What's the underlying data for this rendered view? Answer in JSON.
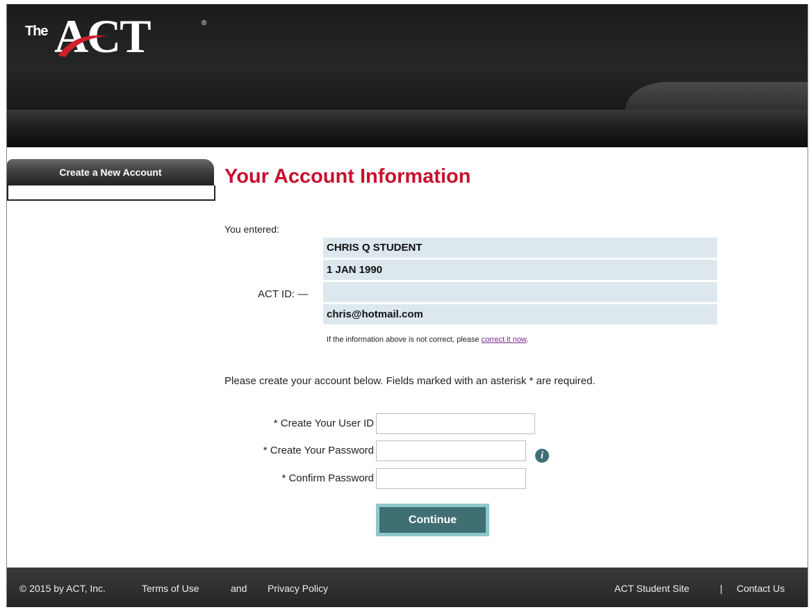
{
  "header": {
    "logo_the": "The",
    "logo_act": "ACT",
    "logo_reg": "®"
  },
  "sidebar": {
    "tab_label": "Create a New Account"
  },
  "main": {
    "title": "Your Account Information",
    "you_entered_label": "You entered:",
    "act_id_label": "ACT ID: —",
    "entered": {
      "name": "CHRIS Q STUDENT",
      "dob": "1 JAN 1990",
      "act_id": "",
      "email": "chris@hotmail.com"
    },
    "correct_note_prefix": "If the information above is not correct, please ",
    "correct_link": "correct it now",
    "correct_note_suffix": ".",
    "instructions": "Please create your account below. Fields marked with an asterisk * are required."
  },
  "form": {
    "user_id_label": "* Create Your User ID",
    "user_id_value": "",
    "password_label": "* Create Your Password",
    "password_value": "",
    "confirm_label": "* Confirm Password",
    "confirm_value": "",
    "info_icon": "info-icon",
    "continue_label": "Continue"
  },
  "footer": {
    "copyright": "© 2015 by ACT, Inc.",
    "terms": "Terms of Use",
    "and": "and",
    "privacy": "Privacy Policy",
    "student_site": "ACT Student Site",
    "separator": "|",
    "contact": "Contact Us"
  },
  "colors": {
    "title_red": "#c8102e",
    "button_teal": "#3f6f72",
    "button_border": "#8ec8cc",
    "info_row_bg": "#dce8ee",
    "link_purple": "#7a2a8a"
  }
}
